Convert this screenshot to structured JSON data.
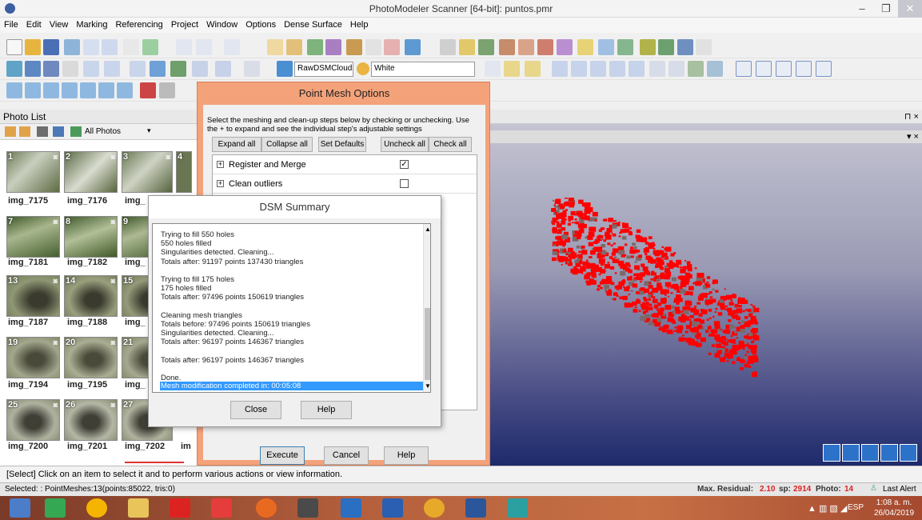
{
  "window": {
    "title": "PhotoModeler Scanner [64-bit]: puntos.pmr",
    "min": "–",
    "max": "❐",
    "close": "✕"
  },
  "menu": [
    "File",
    "Edit",
    "View",
    "Marking",
    "Referencing",
    "Project",
    "Window",
    "Options",
    "Dense Surface",
    "Help"
  ],
  "toolbar": {
    "render_combo": "RawDSMClouds",
    "color_combo": "White"
  },
  "photo_list": {
    "title": "Photo List",
    "pin": "⊓ ×",
    "filter": "All Photos",
    "photos": [
      {
        "num": "1",
        "label": "img_7175"
      },
      {
        "num": "2",
        "label": "img_7176"
      },
      {
        "num": "3",
        "label": "img_"
      },
      {
        "num": "4",
        "label": ""
      },
      {
        "num": "7",
        "label": "img_7181"
      },
      {
        "num": "8",
        "label": "img_7182"
      },
      {
        "num": "9",
        "label": "img_"
      },
      {
        "num": "13",
        "label": "img_7187"
      },
      {
        "num": "14",
        "label": "img_7188"
      },
      {
        "num": "15",
        "label": "img_"
      },
      {
        "num": "19",
        "label": "img_7194"
      },
      {
        "num": "20",
        "label": "img_7195"
      },
      {
        "num": "21",
        "label": "img_"
      },
      {
        "num": "25",
        "label": "img_7200"
      },
      {
        "num": "26",
        "label": "img_7201"
      },
      {
        "num": "27",
        "label": "img_7202"
      },
      {
        "num": "",
        "label": "im"
      }
    ]
  },
  "point_mesh": {
    "title": "Point Mesh Options",
    "instructions": "Select the meshing and clean-up steps below by checking or unchecking. Use the + to expand and see the individual step's adjustable settings",
    "expand_all": "Expand all",
    "collapse_all": "Collapse all",
    "set_defaults": "Set Defaults",
    "uncheck_all": "Uncheck all",
    "check_all": "Check all",
    "steps": [
      {
        "label": "Register and Merge",
        "checked": true
      },
      {
        "label": "Clean outliers",
        "checked": false
      }
    ],
    "execute": "Execute",
    "cancel": "Cancel",
    "help": "Help"
  },
  "dsm_summary": {
    "title": "DSM Summary",
    "log": [
      "Trying to fill 550 holes",
      "550 holes filled",
      "Singularities detected.  Cleaning...",
      "Totals after: 91197 points 137430 triangles",
      "",
      "Trying to fill 175 holes",
      "175 holes filled",
      "Totals after: 97496 points 150619 triangles",
      "",
      "Cleaning mesh triangles",
      "Totals before: 97496 points 150619 triangles",
      "Singularities detected.  Cleaning...",
      "Totals after: 96197 points 146367 triangles",
      "",
      "Totals after: 96197 points 146367 triangles",
      "",
      "Done."
    ],
    "selected_line": "Mesh modification completed in: 00:05:08",
    "close": "Close",
    "help": "Help"
  },
  "status": {
    "message": "[Select] Click on an item to select it and to perform various actions or view information.",
    "selected": "Selected: : PointMeshes:13(points:85022, tris:0)",
    "residual_label": "Max. Residual:",
    "residual": "2.10",
    "sp_label": "sp:",
    "sp": "2914",
    "photo_label": "Photo:",
    "photo": "14",
    "last_alert": "Last Alert"
  },
  "taskbar": {
    "lang": "ESP",
    "time": "1:08 a. m.",
    "date": "26/04/2019"
  },
  "colors": {
    "dialog_accent": "#f4a27a",
    "point_cloud": "#ff0000",
    "selection": "#3399ff"
  }
}
